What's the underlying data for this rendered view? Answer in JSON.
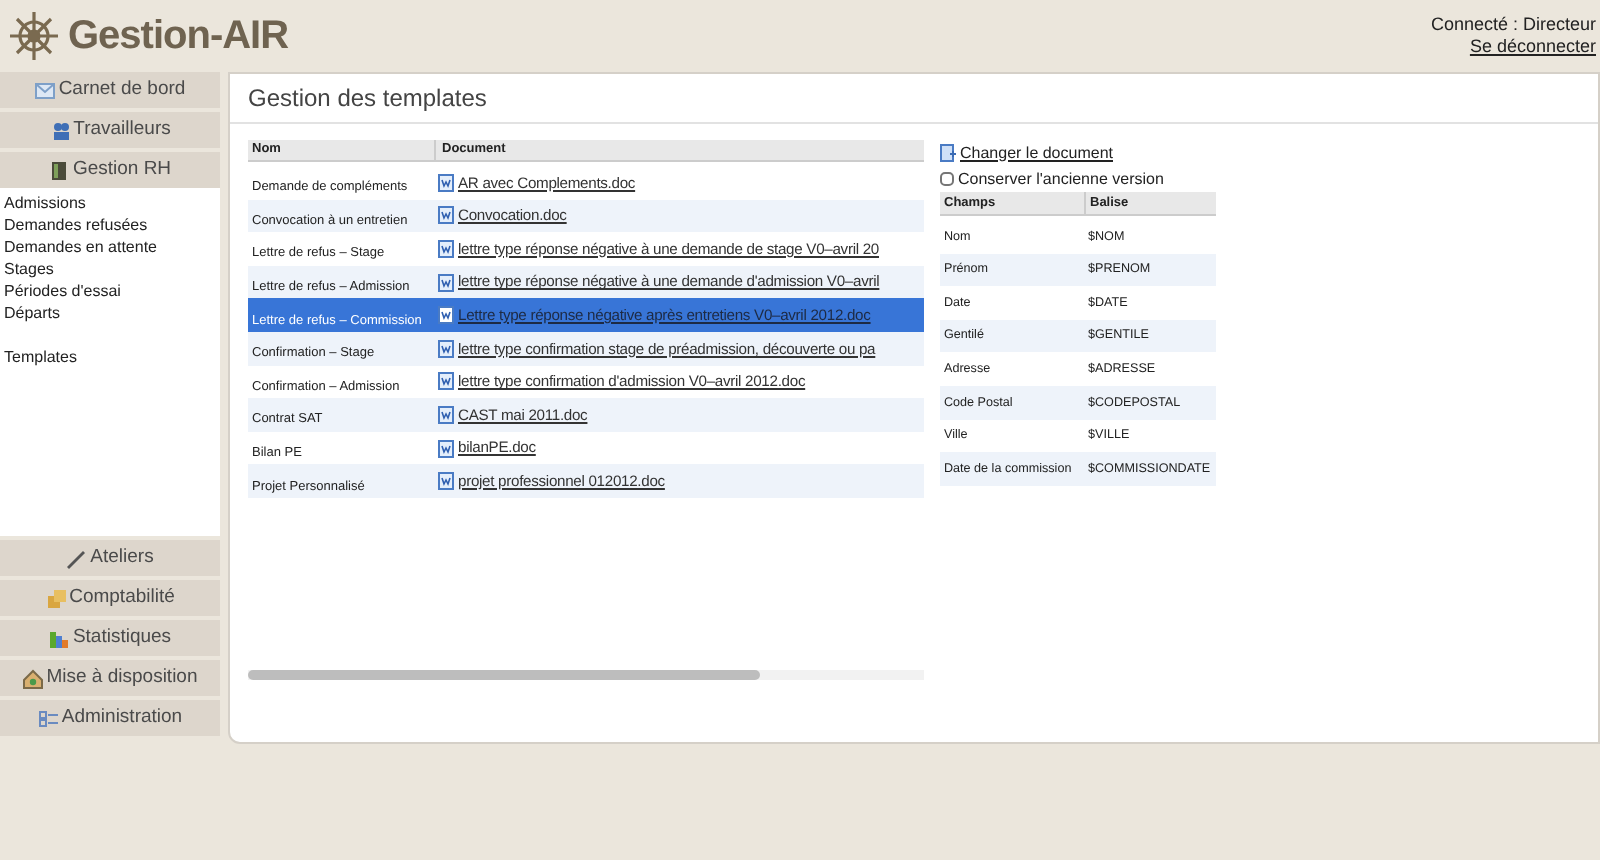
{
  "app": {
    "title": "Gestion-AIR"
  },
  "user": {
    "status": "Connecté : Directeur",
    "logout": "Se déconnecter"
  },
  "nav_top": [
    {
      "label": "Carnet de bord"
    },
    {
      "label": "Travailleurs"
    },
    {
      "label": "Gestion RH"
    }
  ],
  "submenu": [
    {
      "items": [
        "Admissions",
        "Demandes refusées",
        "Demandes en attente",
        "Stages",
        "Périodes d'essai",
        "Départs"
      ]
    },
    {
      "items": [
        "Templates"
      ]
    }
  ],
  "nav_bottom": [
    {
      "label": "Ateliers"
    },
    {
      "label": "Comptabilité"
    },
    {
      "label": "Statistiques"
    },
    {
      "label": "Mise à disposition"
    },
    {
      "label": "Administration"
    }
  ],
  "panel": {
    "title": "Gestion des templates"
  },
  "templates": {
    "columns": [
      "Nom",
      "Document"
    ],
    "rows": [
      {
        "name": "Demande de compléments",
        "document": "AR avec Complements.doc",
        "selected": false
      },
      {
        "name": "Convocation à un entretien",
        "document": "Convocation.doc",
        "selected": false
      },
      {
        "name": "Lettre de refus – Stage",
        "document": "lettre type réponse négative à une demande de stage V0–avril 20",
        "selected": false
      },
      {
        "name": "Lettre de refus – Admission",
        "document": "lettre type réponse négative à une demande d'admission V0–avril",
        "selected": false
      },
      {
        "name": "Lettre de refus – Commission",
        "document": "Lettre type réponse négative après entretiens V0–avril 2012.doc",
        "selected": true
      },
      {
        "name": "Confirmation – Stage",
        "document": "lettre type confirmation stage de préadmission, découverte ou pa",
        "selected": false
      },
      {
        "name": "Confirmation – Admission",
        "document": "lettre type confirmation d'admission V0–avril 2012.doc",
        "selected": false
      },
      {
        "name": "Contrat SAT",
        "document": "CAST mai 2011.doc",
        "selected": false
      },
      {
        "name": "Bilan PE",
        "document": "bilanPE.doc",
        "selected": false
      },
      {
        "name": "Projet Personnalisé",
        "document": "projet professionnel 012012.doc",
        "selected": false
      }
    ]
  },
  "details": {
    "change_link": "Changer le document",
    "keep_old": {
      "label": "Conserver l'ancienne version",
      "checked": false
    },
    "columns": [
      "Champs",
      "Balise"
    ],
    "rows": [
      {
        "field": "Nom",
        "tag": "$NOM"
      },
      {
        "field": "Prénom",
        "tag": "$PRENOM"
      },
      {
        "field": "Date",
        "tag": "$DATE"
      },
      {
        "field": "Gentilé",
        "tag": "$GENTILE"
      },
      {
        "field": "Adresse",
        "tag": "$ADRESSE"
      },
      {
        "field": "Code Postal",
        "tag": "$CODEPOSTAL"
      },
      {
        "field": "Ville",
        "tag": "$VILLE"
      },
      {
        "field": "Date de la commission",
        "tag": "$COMMISSIONDATE"
      }
    ]
  }
}
